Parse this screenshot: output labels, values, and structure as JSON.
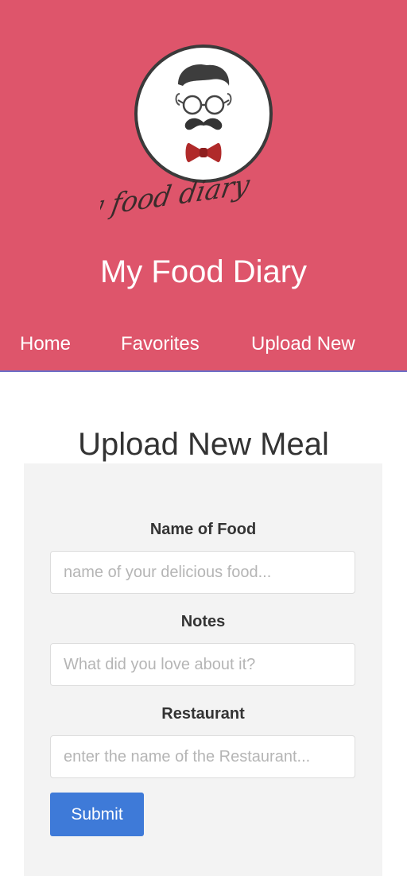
{
  "header": {
    "logo_text": "My food diary",
    "title": "My Food Diary",
    "colors": {
      "background": "#de556b",
      "text": "#ffffff",
      "divider": "#6c6ec7"
    }
  },
  "nav": {
    "items": [
      {
        "label": "Home"
      },
      {
        "label": "Favorites"
      },
      {
        "label": "Upload New"
      }
    ]
  },
  "main": {
    "page_title": "Upload New Meal",
    "form": {
      "fields": [
        {
          "label": "Name of Food",
          "value": "",
          "placeholder": "name of your delicious food..."
        },
        {
          "label": "Notes",
          "value": "",
          "placeholder": "What did you love about it?"
        },
        {
          "label": "Restaurant",
          "value": "",
          "placeholder": "enter the name of the Restaurant..."
        }
      ],
      "submit_label": "Submit",
      "colors": {
        "card": "#f3f3f3",
        "submit": "#3e7ad8"
      }
    }
  }
}
